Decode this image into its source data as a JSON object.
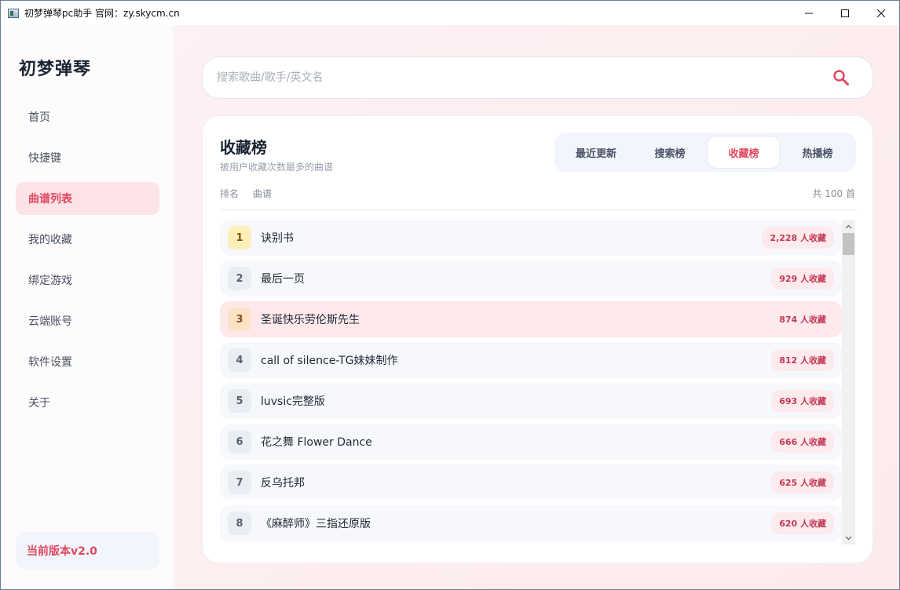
{
  "window": {
    "title": "初梦弹琴pc助手 官网：zy.skycm.cn"
  },
  "sidebar": {
    "brand": "初梦弹琴",
    "items": [
      {
        "label": "首页"
      },
      {
        "label": "快捷键"
      },
      {
        "label": "曲谱列表"
      },
      {
        "label": "我的收藏"
      },
      {
        "label": "绑定游戏"
      },
      {
        "label": "云端账号"
      },
      {
        "label": "软件设置"
      },
      {
        "label": "关于"
      }
    ],
    "active_index": 2,
    "version": "当前版本v2.0"
  },
  "search": {
    "placeholder": "搜索歌曲/歌手/英文名",
    "value": ""
  },
  "ranking": {
    "title": "收藏榜",
    "subtitle": "被用户收藏次数最多的曲谱",
    "tabs": [
      "最近更新",
      "搜索榜",
      "收藏榜",
      "热播榜"
    ],
    "active_tab": "收藏榜",
    "headers": {
      "rank": "排名",
      "song": "曲谱",
      "total": "共 100 首"
    },
    "rows": [
      {
        "rank": "1",
        "song": "诀别书",
        "count": "2,228 人收藏"
      },
      {
        "rank": "2",
        "song": "最后一页",
        "count": "929 人收藏"
      },
      {
        "rank": "3",
        "song": "圣诞快乐劳伦斯先生",
        "count": "874 人收藏"
      },
      {
        "rank": "4",
        "song": "call of silence-TG妹妹制作",
        "count": "812 人收藏"
      },
      {
        "rank": "5",
        "song": "luvsic完整版",
        "count": "693 人收藏"
      },
      {
        "rank": "6",
        "song": "花之舞 Flower Dance",
        "count": "666 人收藏"
      },
      {
        "rank": "7",
        "song": "反乌托邦",
        "count": "625 人收藏"
      },
      {
        "rank": "8",
        "song": "《麻醉师》三指还原版",
        "count": "620 人收藏"
      }
    ]
  },
  "colors": {
    "accent": "#e0475f",
    "active_nav_bg": "#fce3e6",
    "badge_bg": "#fdeaed",
    "rank_gold_bg": "#fdefb8",
    "rank_bronze_bg": "#fde2c6"
  },
  "icons": {
    "search": "search-icon",
    "minimize": "minimize-icon",
    "maximize": "maximize-icon",
    "close": "close-icon"
  }
}
